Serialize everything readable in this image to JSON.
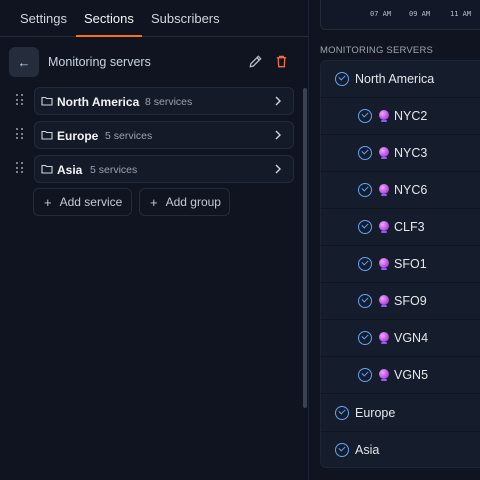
{
  "tabs": [
    {
      "label": "Settings"
    },
    {
      "label": "Sections"
    },
    {
      "label": "Subscribers"
    }
  ],
  "active_tab": "Sections",
  "section": {
    "title": "Monitoring servers"
  },
  "groups": [
    {
      "name": "North America",
      "count": "8 services"
    },
    {
      "name": "Europe",
      "count": "5 services"
    },
    {
      "name": "Asia",
      "count": "5 services"
    }
  ],
  "actions": {
    "add_service": "Add service",
    "add_group": "Add group"
  },
  "chart": {
    "ticks": [
      "07 AM",
      "09 AM",
      "11 AM"
    ]
  },
  "preview": {
    "heading": "MONITORING SERVERS",
    "groups": [
      {
        "name": "North America",
        "services": [
          "NYC2",
          "NYC3",
          "NYC6",
          "CLF3",
          "SFO1",
          "SFO9",
          "VGN4",
          "VGN5"
        ]
      },
      {
        "name": "Europe",
        "services": []
      },
      {
        "name": "Asia",
        "services": []
      }
    ]
  },
  "colors": {
    "accent": "#f97316",
    "check": "#60a5fa",
    "delete": "#f0704a"
  },
  "icons": {
    "back": "arrow-left-icon",
    "edit": "pencil-icon",
    "delete": "trash-icon",
    "folder": "folder-icon",
    "chevron": "chevron-right-icon",
    "drag": "drag-handle-icon",
    "status": "check-circle-icon",
    "service": "globe-icon"
  }
}
